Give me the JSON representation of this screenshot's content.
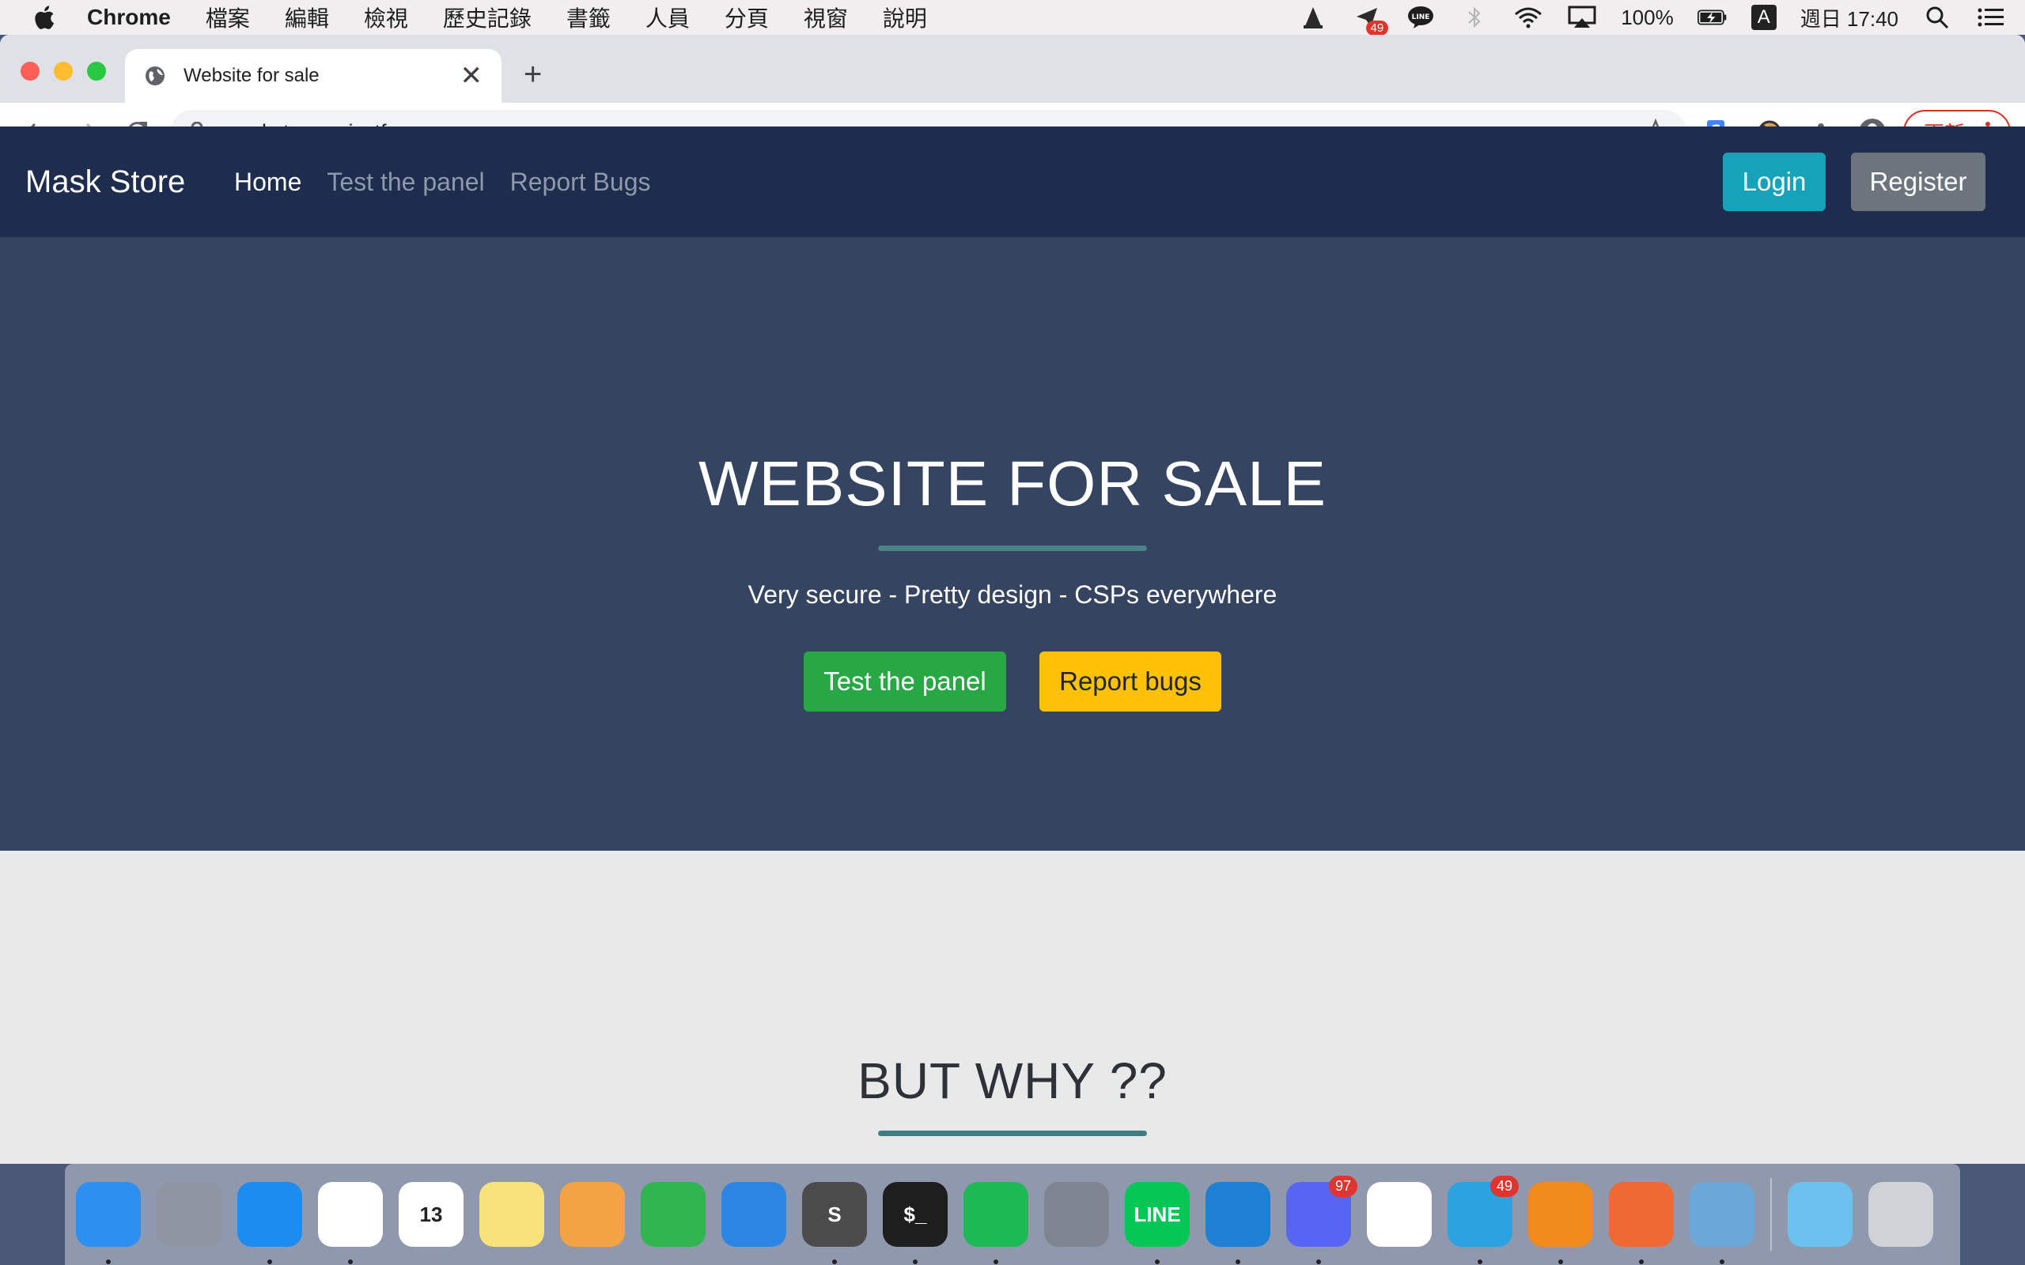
{
  "menubar": {
    "app_name": "Chrome",
    "items": [
      "檔案",
      "編輯",
      "檢視",
      "歷史記錄",
      "書籤",
      "人員",
      "分頁",
      "視窗",
      "說明"
    ],
    "notification_badge": "49",
    "battery": "100%",
    "input_source": "A",
    "clock": "週日 17:40"
  },
  "browser": {
    "tab_title": "Website for sale",
    "close_glyph": "✕",
    "new_tab_glyph": "+",
    "url": "maskstore.asisctf.com",
    "update_label": "更新"
  },
  "site": {
    "brand": "Mask Store",
    "nav": {
      "home": "Home",
      "test_panel": "Test the panel",
      "report_bugs": "Report Bugs"
    },
    "login": "Login",
    "register": "Register",
    "hero": {
      "title": "WEBSITE FOR SALE",
      "tagline": "Very secure - Pretty design - CSPs everywhere",
      "primary_button": "Test the panel",
      "secondary_button": "Report bugs"
    },
    "section": {
      "title": "BUT WHY ??"
    }
  },
  "dock": {
    "apps": [
      {
        "name": "finder-icon",
        "color": "#2d8fef"
      },
      {
        "name": "launchpad-icon",
        "color": "#8f96a3"
      },
      {
        "name": "safari-icon",
        "color": "#1d8cf0"
      },
      {
        "name": "chrome-icon",
        "color": "#ffffff"
      },
      {
        "name": "calendar-icon",
        "color": "#ffffff",
        "label": "13"
      },
      {
        "name": "notes-icon",
        "color": "#f8e27a"
      },
      {
        "name": "pages-icon",
        "color": "#f3a244"
      },
      {
        "name": "numbers-icon",
        "color": "#2fb550"
      },
      {
        "name": "keynote-icon",
        "color": "#2a86e2"
      },
      {
        "name": "sublime-text-icon",
        "color": "#4b4b4b",
        "label": "S"
      },
      {
        "name": "terminal-icon",
        "color": "#1e1e1e",
        "label": "$_"
      },
      {
        "name": "spotify-icon",
        "color": "#1db954"
      },
      {
        "name": "system-preferences-icon",
        "color": "#7f8590"
      },
      {
        "name": "line-icon",
        "color": "#06c755",
        "label": "LINE"
      },
      {
        "name": "vscode-icon",
        "color": "#1f7fd2"
      },
      {
        "name": "discord-icon",
        "color": "#5865f2",
        "badge": "97"
      },
      {
        "name": "slack-icon",
        "color": "#ffffff"
      },
      {
        "name": "telegram-icon",
        "color": "#2aa3e0",
        "badge": "49"
      },
      {
        "name": "vlc-icon",
        "color": "#f08a1c"
      },
      {
        "name": "burp-suite-icon",
        "color": "#ef6a33"
      },
      {
        "name": "preview-icon",
        "color": "#6ba8d8"
      },
      {
        "name": "downloads-folder-icon",
        "color": "#6cc1ef"
      },
      {
        "name": "trash-icon",
        "color": "#cfd3d8"
      }
    ]
  }
}
